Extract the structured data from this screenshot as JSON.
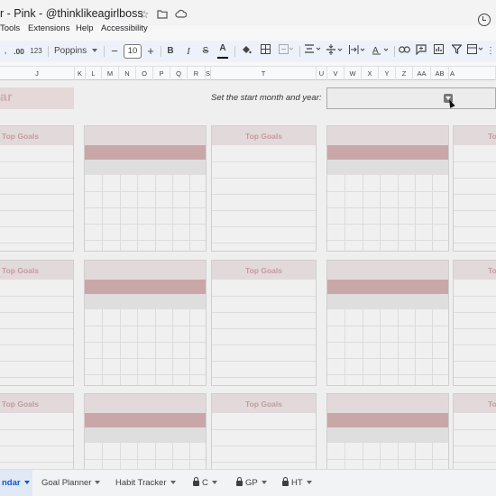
{
  "window": {
    "title": "r - Pink - @thinklikeagirlboss",
    "icons": [
      "star-icon",
      "move-to-folder-icon",
      "cloud-status-icon",
      "version-history-icon"
    ]
  },
  "menu": [
    "Tools",
    "Extensions",
    "Help",
    "Accessibility"
  ],
  "toolbar": {
    "decimal_increase": ".00",
    "number_format": "123",
    "font_name": "Poppins",
    "minus": "−",
    "font_size": "10",
    "plus": "+",
    "bold": "B",
    "italic": "I",
    "strikethrough": "S",
    "text_color": "A"
  },
  "columns": [
    "J",
    "K",
    "L",
    "M",
    "N",
    "O",
    "P",
    "Q",
    "R",
    "S",
    "T",
    "U",
    "V",
    "W",
    "X",
    "Y",
    "Z",
    "AA",
    "AB",
    "A"
  ],
  "sheet": {
    "calendar_title": "ar",
    "start_prompt": "Set the start month and year:",
    "goal_header": "Top Goals",
    "goal_header_short": "To"
  },
  "tabs": [
    {
      "label": "ndar",
      "active": true
    },
    {
      "label": "Goal Planner",
      "active": false
    },
    {
      "label": "Habit Tracker",
      "active": false
    },
    {
      "label": "C",
      "active": false,
      "locked": true
    },
    {
      "label": "GP",
      "active": false,
      "locked": true
    },
    {
      "label": "HT",
      "active": false,
      "locked": true
    }
  ],
  "colors": {
    "goal_header_bg": "#e2dada",
    "goal_header_text": "#c59a9e",
    "calendar_band": "#c9a7a8",
    "active_tab": "#0b57d0"
  }
}
